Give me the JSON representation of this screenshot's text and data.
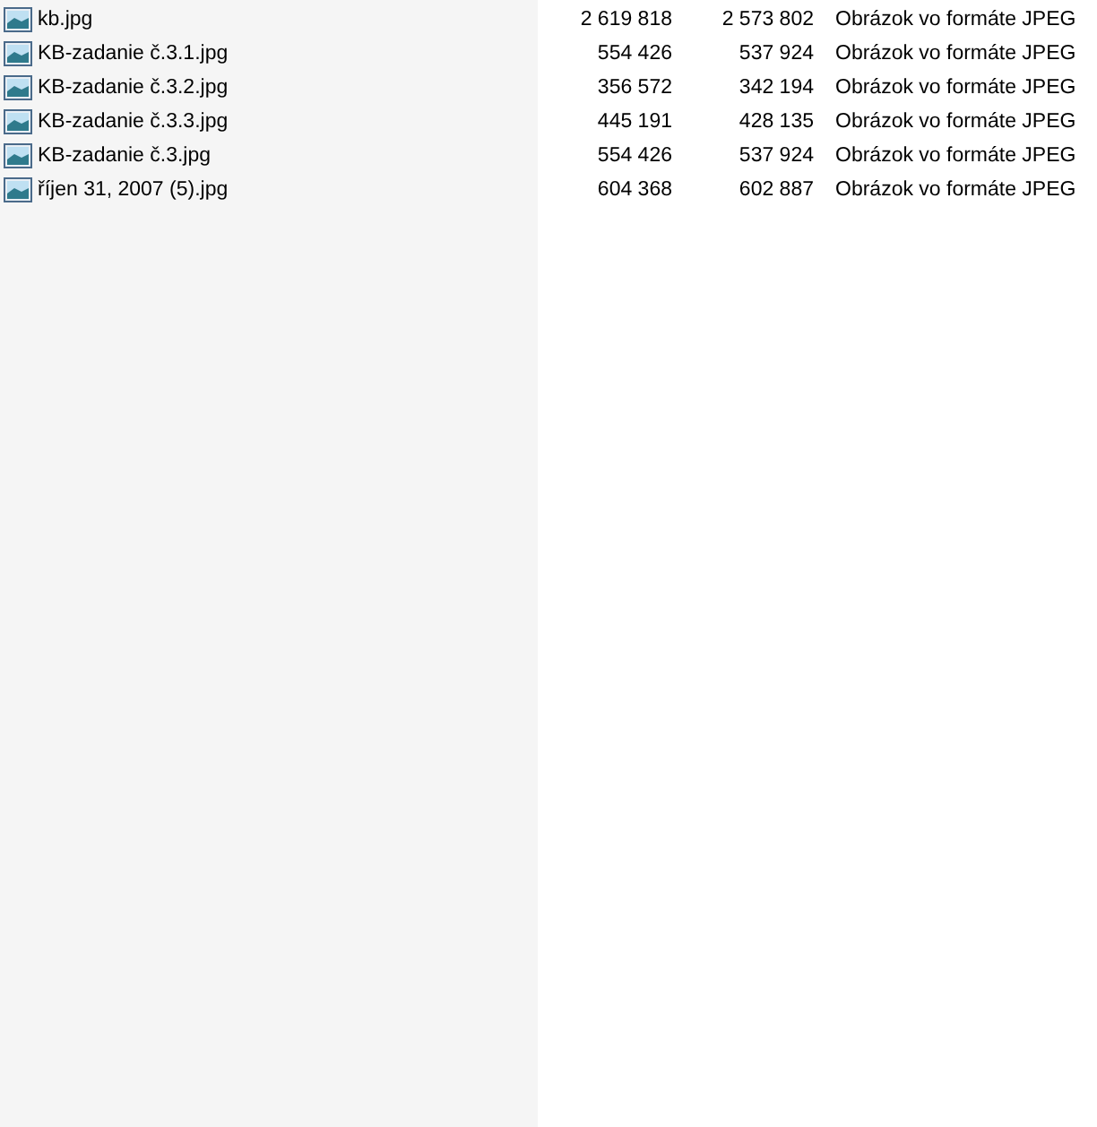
{
  "files": [
    {
      "name": "kb.jpg",
      "size": "2 619 818",
      "packed": "2 573 802",
      "type": "Obrázok vo formáte JPEG"
    },
    {
      "name": "KB-zadanie č.3.1.jpg",
      "size": "554 426",
      "packed": "537 924",
      "type": "Obrázok vo formáte JPEG"
    },
    {
      "name": "KB-zadanie č.3.2.jpg",
      "size": "356 572",
      "packed": "342 194",
      "type": "Obrázok vo formáte JPEG"
    },
    {
      "name": "KB-zadanie č.3.3.jpg",
      "size": "445 191",
      "packed": "428 135",
      "type": "Obrázok vo formáte JPEG"
    },
    {
      "name": "KB-zadanie č.3.jpg",
      "size": "554 426",
      "packed": "537 924",
      "type": "Obrázok vo formáte JPEG"
    },
    {
      "name": "říjen 31, 2007 (5).jpg",
      "size": "604 368",
      "packed": "602 887",
      "type": "Obrázok vo formáte JPEG"
    }
  ]
}
